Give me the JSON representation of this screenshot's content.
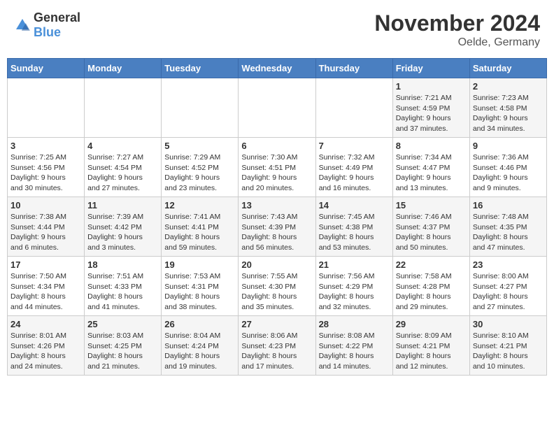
{
  "header": {
    "logo_general": "General",
    "logo_blue": "Blue",
    "month_year": "November 2024",
    "location": "Oelde, Germany"
  },
  "days_of_week": [
    "Sunday",
    "Monday",
    "Tuesday",
    "Wednesday",
    "Thursday",
    "Friday",
    "Saturday"
  ],
  "weeks": [
    [
      {
        "day": "",
        "info": ""
      },
      {
        "day": "",
        "info": ""
      },
      {
        "day": "",
        "info": ""
      },
      {
        "day": "",
        "info": ""
      },
      {
        "day": "",
        "info": ""
      },
      {
        "day": "1",
        "info": "Sunrise: 7:21 AM\nSunset: 4:59 PM\nDaylight: 9 hours\nand 37 minutes."
      },
      {
        "day": "2",
        "info": "Sunrise: 7:23 AM\nSunset: 4:58 PM\nDaylight: 9 hours\nand 34 minutes."
      }
    ],
    [
      {
        "day": "3",
        "info": "Sunrise: 7:25 AM\nSunset: 4:56 PM\nDaylight: 9 hours\nand 30 minutes."
      },
      {
        "day": "4",
        "info": "Sunrise: 7:27 AM\nSunset: 4:54 PM\nDaylight: 9 hours\nand 27 minutes."
      },
      {
        "day": "5",
        "info": "Sunrise: 7:29 AM\nSunset: 4:52 PM\nDaylight: 9 hours\nand 23 minutes."
      },
      {
        "day": "6",
        "info": "Sunrise: 7:30 AM\nSunset: 4:51 PM\nDaylight: 9 hours\nand 20 minutes."
      },
      {
        "day": "7",
        "info": "Sunrise: 7:32 AM\nSunset: 4:49 PM\nDaylight: 9 hours\nand 16 minutes."
      },
      {
        "day": "8",
        "info": "Sunrise: 7:34 AM\nSunset: 4:47 PM\nDaylight: 9 hours\nand 13 minutes."
      },
      {
        "day": "9",
        "info": "Sunrise: 7:36 AM\nSunset: 4:46 PM\nDaylight: 9 hours\nand 9 minutes."
      }
    ],
    [
      {
        "day": "10",
        "info": "Sunrise: 7:38 AM\nSunset: 4:44 PM\nDaylight: 9 hours\nand 6 minutes."
      },
      {
        "day": "11",
        "info": "Sunrise: 7:39 AM\nSunset: 4:42 PM\nDaylight: 9 hours\nand 3 minutes."
      },
      {
        "day": "12",
        "info": "Sunrise: 7:41 AM\nSunset: 4:41 PM\nDaylight: 8 hours\nand 59 minutes."
      },
      {
        "day": "13",
        "info": "Sunrise: 7:43 AM\nSunset: 4:39 PM\nDaylight: 8 hours\nand 56 minutes."
      },
      {
        "day": "14",
        "info": "Sunrise: 7:45 AM\nSunset: 4:38 PM\nDaylight: 8 hours\nand 53 minutes."
      },
      {
        "day": "15",
        "info": "Sunrise: 7:46 AM\nSunset: 4:37 PM\nDaylight: 8 hours\nand 50 minutes."
      },
      {
        "day": "16",
        "info": "Sunrise: 7:48 AM\nSunset: 4:35 PM\nDaylight: 8 hours\nand 47 minutes."
      }
    ],
    [
      {
        "day": "17",
        "info": "Sunrise: 7:50 AM\nSunset: 4:34 PM\nDaylight: 8 hours\nand 44 minutes."
      },
      {
        "day": "18",
        "info": "Sunrise: 7:51 AM\nSunset: 4:33 PM\nDaylight: 8 hours\nand 41 minutes."
      },
      {
        "day": "19",
        "info": "Sunrise: 7:53 AM\nSunset: 4:31 PM\nDaylight: 8 hours\nand 38 minutes."
      },
      {
        "day": "20",
        "info": "Sunrise: 7:55 AM\nSunset: 4:30 PM\nDaylight: 8 hours\nand 35 minutes."
      },
      {
        "day": "21",
        "info": "Sunrise: 7:56 AM\nSunset: 4:29 PM\nDaylight: 8 hours\nand 32 minutes."
      },
      {
        "day": "22",
        "info": "Sunrise: 7:58 AM\nSunset: 4:28 PM\nDaylight: 8 hours\nand 29 minutes."
      },
      {
        "day": "23",
        "info": "Sunrise: 8:00 AM\nSunset: 4:27 PM\nDaylight: 8 hours\nand 27 minutes."
      }
    ],
    [
      {
        "day": "24",
        "info": "Sunrise: 8:01 AM\nSunset: 4:26 PM\nDaylight: 8 hours\nand 24 minutes."
      },
      {
        "day": "25",
        "info": "Sunrise: 8:03 AM\nSunset: 4:25 PM\nDaylight: 8 hours\nand 21 minutes."
      },
      {
        "day": "26",
        "info": "Sunrise: 8:04 AM\nSunset: 4:24 PM\nDaylight: 8 hours\nand 19 minutes."
      },
      {
        "day": "27",
        "info": "Sunrise: 8:06 AM\nSunset: 4:23 PM\nDaylight: 8 hours\nand 17 minutes."
      },
      {
        "day": "28",
        "info": "Sunrise: 8:08 AM\nSunset: 4:22 PM\nDaylight: 8 hours\nand 14 minutes."
      },
      {
        "day": "29",
        "info": "Sunrise: 8:09 AM\nSunset: 4:21 PM\nDaylight: 8 hours\nand 12 minutes."
      },
      {
        "day": "30",
        "info": "Sunrise: 8:10 AM\nSunset: 4:21 PM\nDaylight: 8 hours\nand 10 minutes."
      }
    ]
  ]
}
